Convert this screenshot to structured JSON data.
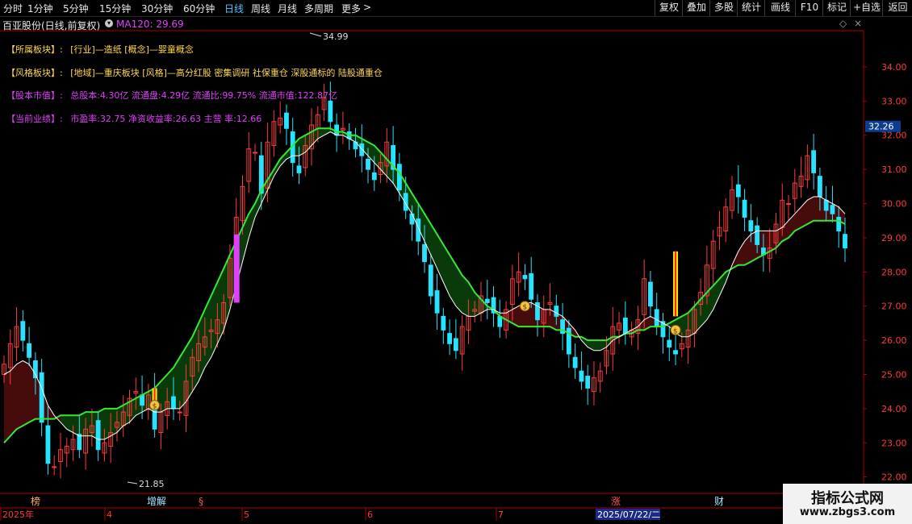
{
  "toolbar": {
    "periods": [
      "分时",
      "1分钟",
      "5分钟",
      "15分钟",
      "30分钟",
      "60分钟",
      "日线",
      "周线",
      "月线",
      "多周期",
      "更多"
    ],
    "active_index": 6,
    "more_arrow": ">",
    "right_buttons": [
      "复权",
      "叠加",
      "多股",
      "统计",
      "画线",
      "F10",
      "标记",
      "+自选",
      "返回"
    ]
  },
  "title": {
    "stock": "百亚股份(日线,前复权)",
    "ma_label": "MA120: 29.69",
    "settings_icon": "diamond-icon"
  },
  "info": [
    {
      "tag": "【所属板块】:",
      "text": "[行业]—造纸 [概念]—婴童概念",
      "color": "#ffd84a"
    },
    {
      "tag": "【风格板块】:",
      "text": "[地域]—重庆板块 [风格]—高分红股 密集调研 社保重仓 深股通标的 陆股通重仓",
      "color": "#ffd84a"
    },
    {
      "tag": "【股本市值】:",
      "text": "总股本:4.30亿 流通盘:4.29亿 流通比:99.75% 流通市值:122.87亿",
      "color": "#e040fb"
    },
    {
      "tag": "【当前业绩】:",
      "text": "市盈率:32.75 净资收益率:26.63 主营 率:12.66",
      "color": "#e040fb"
    }
  ],
  "chart_data": {
    "type": "candlestick",
    "y_axis": {
      "min": 21.85,
      "max": 34.99,
      "ticks": [
        "34.00",
        "33.00",
        "32.00",
        "31.00",
        "30.00",
        "29.00",
        "28.00",
        "27.00",
        "26.00",
        "25.00",
        "24.00",
        "23.00",
        "22.00"
      ]
    },
    "current_price_label": "32.26",
    "high_label": "34.99",
    "low_label": "21.85",
    "x_labels": [
      "2025年",
      "4",
      "5",
      "6",
      "7"
    ],
    "cursor_date": "2025/07/22/二",
    "bottom_markers": [
      "榜",
      "增解",
      "§",
      "涨",
      "财"
    ],
    "closes": [
      25.3,
      25.9,
      26.4,
      26.0,
      25.5,
      24.9,
      23.6,
      22.4,
      22.3,
      22.8,
      22.9,
      23.1,
      22.8,
      23.4,
      23.5,
      22.8,
      23.0,
      23.3,
      23.6,
      23.9,
      24.3,
      24.5,
      24.1,
      24.4,
      23.4,
      23.9,
      24.2,
      24.0,
      23.9,
      24.8,
      25.5,
      25.9,
      26.1,
      26.3,
      26.6,
      27.1,
      28.4,
      29.6,
      30.5,
      31.6,
      31.5,
      30.3,
      31.8,
      32.4,
      32.5,
      32.2,
      31.2,
      30.9,
      31.7,
      32.3,
      32.6,
      33.1,
      32.4,
      32.0,
      32.2,
      31.9,
      31.6,
      31.4,
      31.0,
      30.7,
      31.2,
      31.8,
      31.0,
      30.4,
      29.8,
      29.4,
      28.9,
      28.3,
      27.3,
      26.8,
      26.3,
      25.9,
      25.7,
      26.4,
      26.7,
      26.9,
      27.3,
      27.1,
      26.8,
      26.4,
      26.9,
      27.8,
      28.0,
      27.8,
      27.2,
      26.6,
      26.9,
      27.1,
      26.7,
      26.2,
      25.6,
      25.2,
      24.8,
      24.6,
      24.9,
      25.1,
      25.7,
      26.4,
      26.5,
      26.2,
      26.3,
      26.6,
      27.8,
      27.0,
      26.4,
      26.1,
      25.8,
      25.6,
      25.9,
      26.3,
      26.9,
      27.4,
      28.2,
      28.9,
      29.3,
      29.9,
      30.4,
      30.2,
      29.6,
      29.2,
      28.8,
      28.5,
      28.7,
      29.4,
      30.1,
      30.0,
      30.6,
      30.8,
      31.4,
      30.9,
      30.2,
      29.8,
      29.7,
      29.2,
      28.7
    ],
    "ma_short": [
      25.0,
      25.1,
      25.3,
      25.4,
      25.3,
      25.0,
      24.6,
      24.1,
      23.8,
      23.6,
      23.4,
      23.3,
      23.2,
      23.2,
      23.2,
      23.1,
      23.1,
      23.2,
      23.3,
      23.5,
      23.6,
      23.8,
      23.9,
      24.0,
      23.9,
      23.9,
      24.0,
      24.0,
      24.0,
      24.2,
      24.5,
      24.8,
      25.2,
      25.5,
      25.9,
      26.3,
      26.9,
      27.6,
      28.3,
      29.0,
      29.6,
      30.0,
      30.4,
      30.8,
      31.1,
      31.3,
      31.4,
      31.4,
      31.5,
      31.7,
      31.9,
      32.0,
      32.1,
      32.0,
      32.0,
      31.9,
      31.8,
      31.6,
      31.4,
      31.2,
      31.0,
      30.8,
      30.6,
      30.3,
      30.0,
      29.7,
      29.3,
      28.9,
      28.5,
      28.1,
      27.7,
      27.3,
      27.0,
      26.8,
      26.7,
      26.7,
      26.8,
      26.9,
      26.9,
      26.8,
      26.8,
      26.9,
      27.0,
      27.1,
      27.1,
      27.0,
      26.9,
      26.9,
      26.8,
      26.7,
      26.5,
      26.3,
      26.0,
      25.8,
      25.7,
      25.7,
      25.8,
      26.0,
      26.1,
      26.2,
      26.3,
      26.4,
      26.6,
      26.7,
      26.6,
      26.5,
      26.4,
      26.2,
      26.1,
      26.1,
      26.2,
      26.4,
      26.6,
      26.9,
      27.3,
      27.7,
      28.2,
      28.6,
      28.9,
      29.1,
      29.2,
      29.2,
      29.2,
      29.2,
      29.3,
      29.5,
      29.7,
      29.9,
      30.1,
      30.2,
      30.2,
      30.1,
      30.0,
      29.9,
      29.7
    ],
    "ma_long": [
      23.0,
      23.2,
      23.4,
      23.5,
      23.6,
      23.7,
      23.7,
      23.7,
      23.7,
      23.8,
      23.8,
      23.8,
      23.8,
      23.9,
      23.9,
      23.9,
      24.0,
      24.0,
      24.0,
      24.1,
      24.2,
      24.3,
      24.4,
      24.5,
      24.6,
      24.8,
      25.0,
      25.2,
      25.5,
      25.8,
      26.1,
      26.5,
      26.9,
      27.3,
      27.7,
      28.1,
      28.5,
      28.9,
      29.3,
      29.7,
      30.0,
      30.4,
      30.7,
      31.0,
      31.3,
      31.5,
      31.7,
      31.9,
      32.0,
      32.1,
      32.2,
      32.2,
      32.2,
      32.1,
      32.1,
      32.0,
      32.0,
      31.9,
      31.8,
      31.7,
      31.5,
      31.3,
      31.1,
      30.9,
      30.6,
      30.3,
      30.0,
      29.7,
      29.4,
      29.1,
      28.8,
      28.5,
      28.2,
      27.9,
      27.7,
      27.4,
      27.2,
      27.0,
      26.9,
      26.7,
      26.6,
      26.5,
      26.4,
      26.4,
      26.4,
      26.4,
      26.4,
      26.4,
      26.3,
      26.3,
      26.2,
      26.1,
      26.1,
      26.0,
      26.0,
      26.0,
      26.0,
      26.1,
      26.1,
      26.2,
      26.2,
      26.3,
      26.3,
      26.4,
      26.4,
      26.4,
      26.5,
      26.6,
      26.7,
      26.8,
      27.0,
      27.2,
      27.4,
      27.6,
      27.8,
      28.0,
      28.1,
      28.2,
      28.2,
      28.3,
      28.4,
      28.5,
      28.6,
      28.7,
      28.9,
      29.0,
      29.2,
      29.3,
      29.4,
      29.5,
      29.5,
      29.5,
      29.5,
      29.5,
      29.4
    ],
    "signals": [
      {
        "type": "yellow-bar",
        "index": 24,
        "from": 24.2,
        "to": 24.6
      },
      {
        "type": "magenta-bar",
        "index": 37,
        "from": 27.1,
        "to": 29.1
      },
      {
        "type": "yellow-bar",
        "index": 107,
        "from": 26.7,
        "to": 28.6
      },
      {
        "type": "coin",
        "index": 24,
        "y": 24.1
      },
      {
        "type": "coin",
        "index": 83,
        "y": 27.0
      },
      {
        "type": "coin",
        "index": 107,
        "y": 26.3
      }
    ]
  },
  "colors": {
    "up": "#ff3b3b",
    "down": "#27e3ff",
    "ma_long": "#35e835",
    "ma_short": "#ffffff",
    "fill_up": "#4a0d0d",
    "fill_down": "#0b3d0b",
    "axis": "#b00000",
    "tick_text": "#ff3b3b",
    "active_period": "#4fc3ff",
    "current_price_bg": "#0b3f8e"
  },
  "watermark": {
    "line1": "指标公式网",
    "line2": "www.zbgs3.com"
  }
}
